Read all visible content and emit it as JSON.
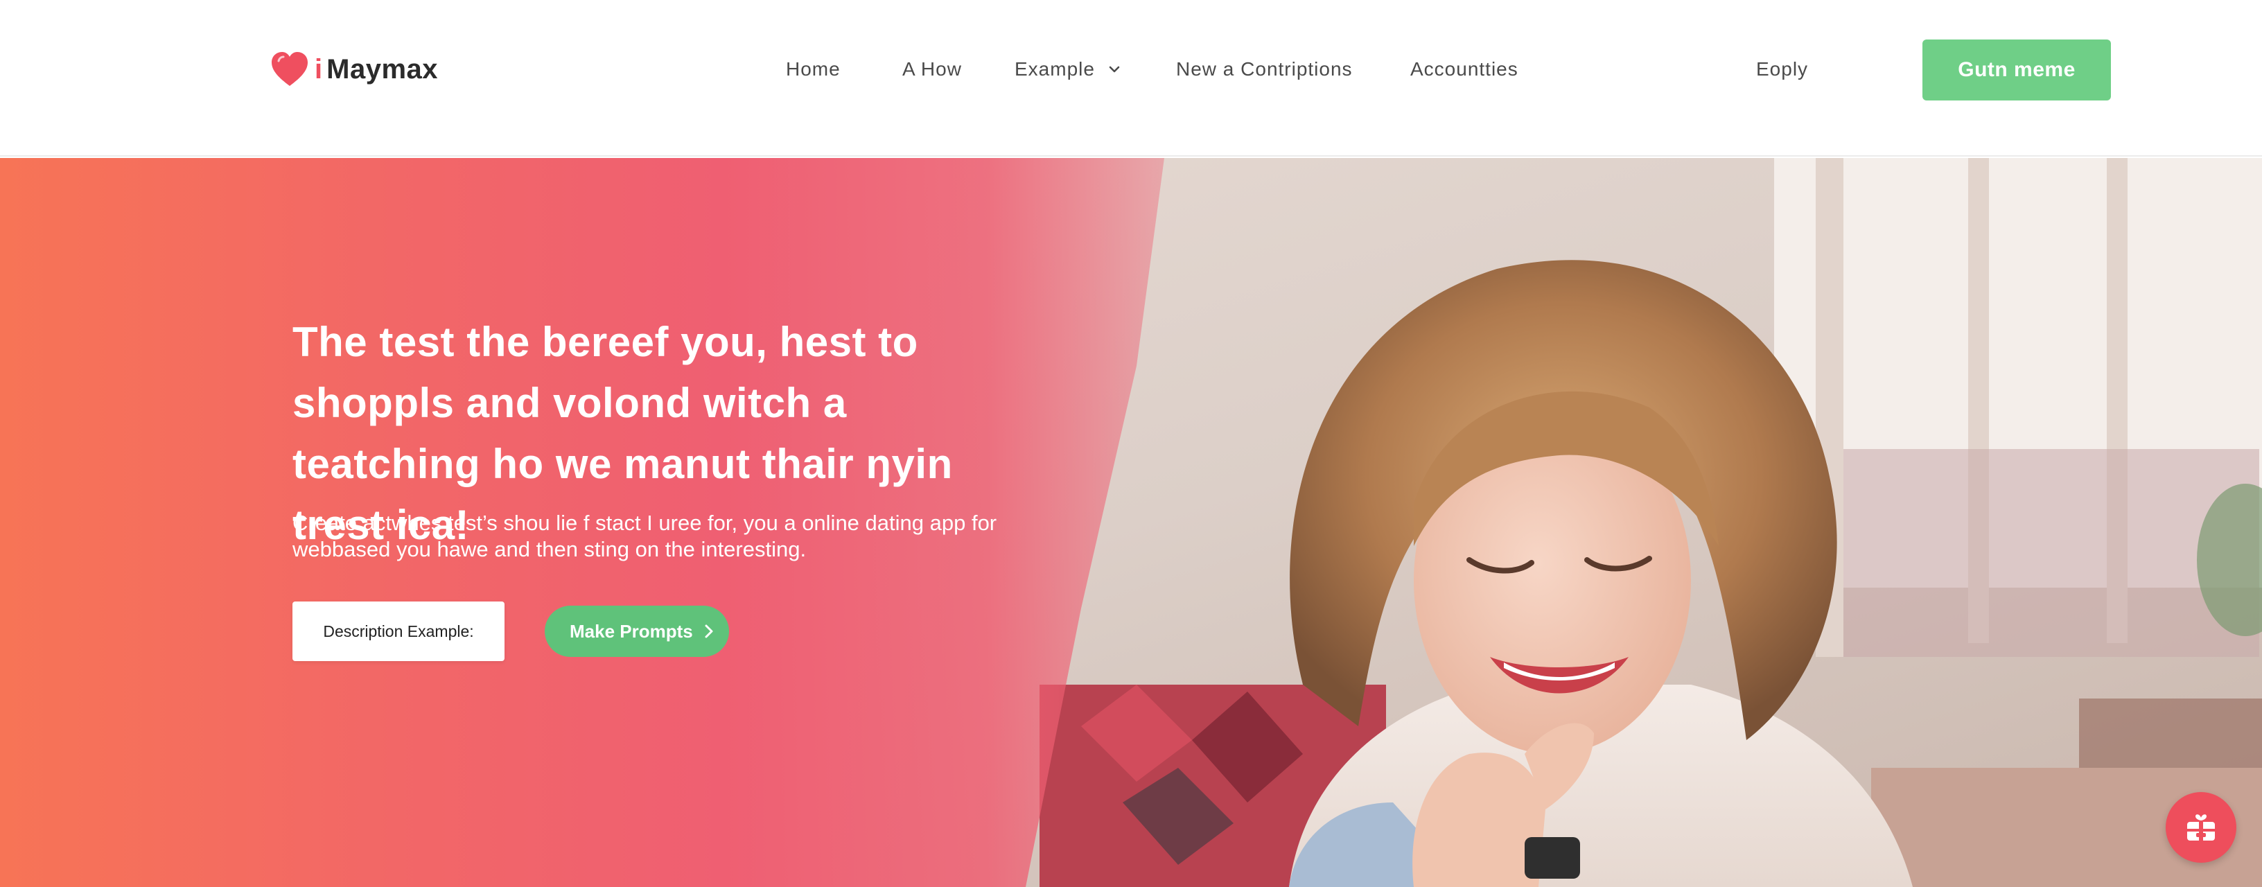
{
  "brand": {
    "logo_i": "i",
    "name": "Maymax",
    "logo_icon": "heart-icon",
    "accent_color": "#ef4f5f"
  },
  "nav": {
    "items": [
      {
        "label": "Home"
      },
      {
        "label": "A How"
      },
      {
        "label": "Example",
        "icon": "chevron-down-icon"
      },
      {
        "label": "New a Contriptions"
      },
      {
        "label": "Accountties"
      },
      {
        "label": "Eoply"
      }
    ],
    "cta_label": "Gutn meme",
    "cta_color": "#6fcf87"
  },
  "hero": {
    "title": "The test the bereef you, hest to shoppls and volond witch a teatching ho we manut thair ŋyin trest ica!",
    "subtitle": "Create actwhes test’s shou lie f stact I uree for, you a online dating app for webbased you hawe and then sting on the interesting.",
    "description_button": "Description Example:",
    "prompts_button": "Make Prompts",
    "prompts_icon": "chevron-right-icon",
    "gradient_colors": [
      "#f77456",
      "#ef5f72"
    ],
    "button_green": "#5fc27a"
  },
  "fab": {
    "icon": "gift-icon",
    "color": "#ee4e5c"
  }
}
